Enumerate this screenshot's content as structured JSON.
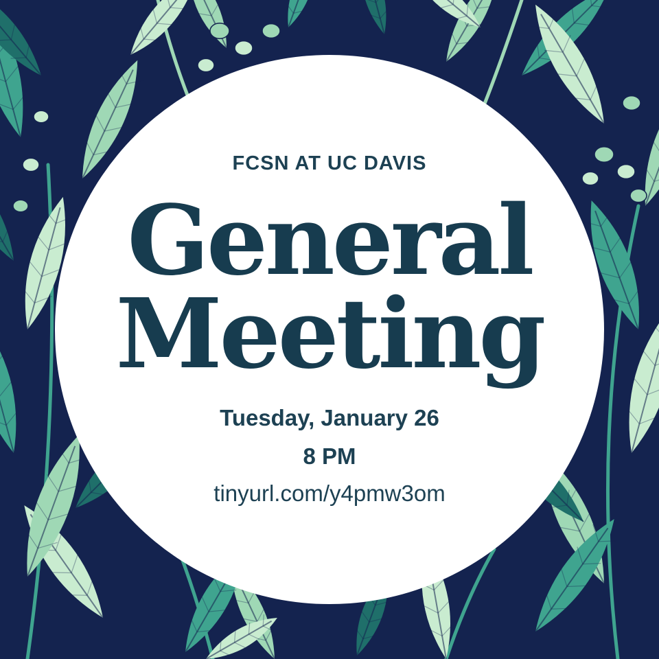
{
  "poster": {
    "organization": "FCSN AT UC DAVIS",
    "title_line1": "General",
    "title_line2": "Meeting",
    "date": "Tuesday, January 26",
    "time": "8 PM",
    "link": "tinyurl.com/y4pmw3om"
  },
  "colors": {
    "background": "#14234f",
    "circle": "#ffffff",
    "text": "#183a4e",
    "leaf_dark": "#1f6f6a",
    "leaf_mid": "#3fa48f",
    "leaf_light": "#9fd8b5",
    "leaf_pale": "#c9ecd0"
  },
  "background_pattern": "botanical-leaves"
}
